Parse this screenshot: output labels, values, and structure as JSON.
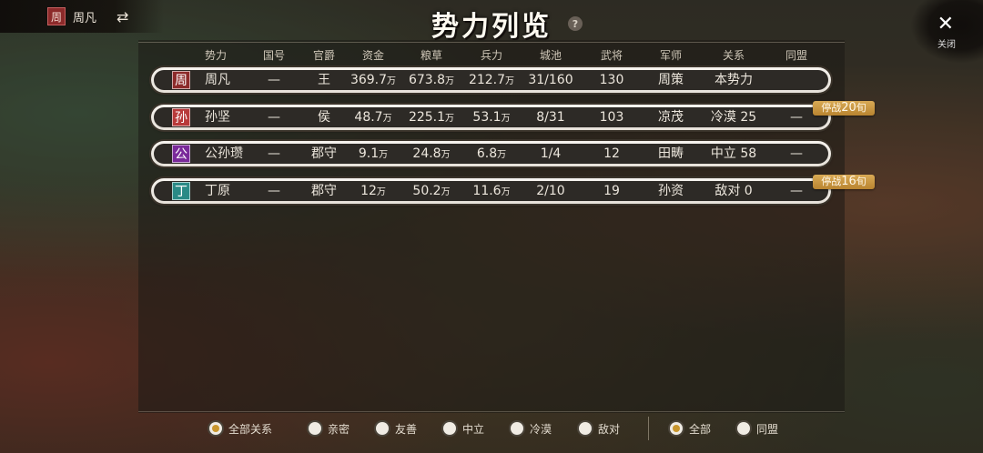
{
  "player": {
    "seal": "周",
    "name": "周凡",
    "swap_icon": "⇄"
  },
  "title": "势力列览",
  "help_icon": "?",
  "close": {
    "icon": "✕",
    "label": "关闭"
  },
  "columns": [
    "势力",
    "国号",
    "官爵",
    "资金",
    "粮草",
    "兵力",
    "城池",
    "武将",
    "军师",
    "关系",
    "同盟"
  ],
  "unit": "万",
  "rows": [
    {
      "seal": "周",
      "seal_color": "#8c2a2a",
      "name": "周凡",
      "state": "—",
      "rank": "王",
      "funds": "369.7",
      "grain": "673.8",
      "troops": "212.7",
      "cities": "31/160",
      "generals": "130",
      "advisor": "周策",
      "relation": "本势力",
      "alliance": ""
    },
    {
      "seal": "孙",
      "seal_color": "#b83a3a",
      "name": "孙坚",
      "state": "—",
      "rank": "侯",
      "funds": "48.7",
      "grain": "225.1",
      "troops": "53.1",
      "cities": "8/31",
      "generals": "103",
      "advisor": "凉茂",
      "relation": "冷漠 25",
      "alliance": "—",
      "ceasefire": {
        "label": "停战",
        "value": "20",
        "unit": "旬"
      }
    },
    {
      "seal": "公",
      "seal_color": "#7a2a9a",
      "name": "公孙瓒",
      "state": "—",
      "rank": "郡守",
      "funds": "9.1",
      "grain": "24.8",
      "troops": "6.8",
      "cities": "1/4",
      "generals": "12",
      "advisor": "田畴",
      "relation": "中立 58",
      "alliance": "—"
    },
    {
      "seal": "丁",
      "seal_color": "#2a8a86",
      "name": "丁原",
      "state": "—",
      "rank": "郡守",
      "funds": "12",
      "grain": "50.2",
      "troops": "11.6",
      "cities": "2/10",
      "generals": "19",
      "advisor": "孙资",
      "relation": "敌对 0",
      "alliance": "—",
      "ceasefire": {
        "label": "停战",
        "value": "16",
        "unit": "旬"
      }
    }
  ],
  "filters": {
    "relations": [
      {
        "label": "全部关系",
        "checked": true
      },
      {
        "label": "亲密",
        "checked": false
      },
      {
        "label": "友善",
        "checked": false
      },
      {
        "label": "中立",
        "checked": false
      },
      {
        "label": "冷漠",
        "checked": false
      },
      {
        "label": "敌对",
        "checked": false
      }
    ],
    "alliance": [
      {
        "label": "全部",
        "checked": true
      },
      {
        "label": "同盟",
        "checked": false
      }
    ]
  },
  "colors": {
    "accent": "#c8962e",
    "ceasefire": "#c99440"
  }
}
